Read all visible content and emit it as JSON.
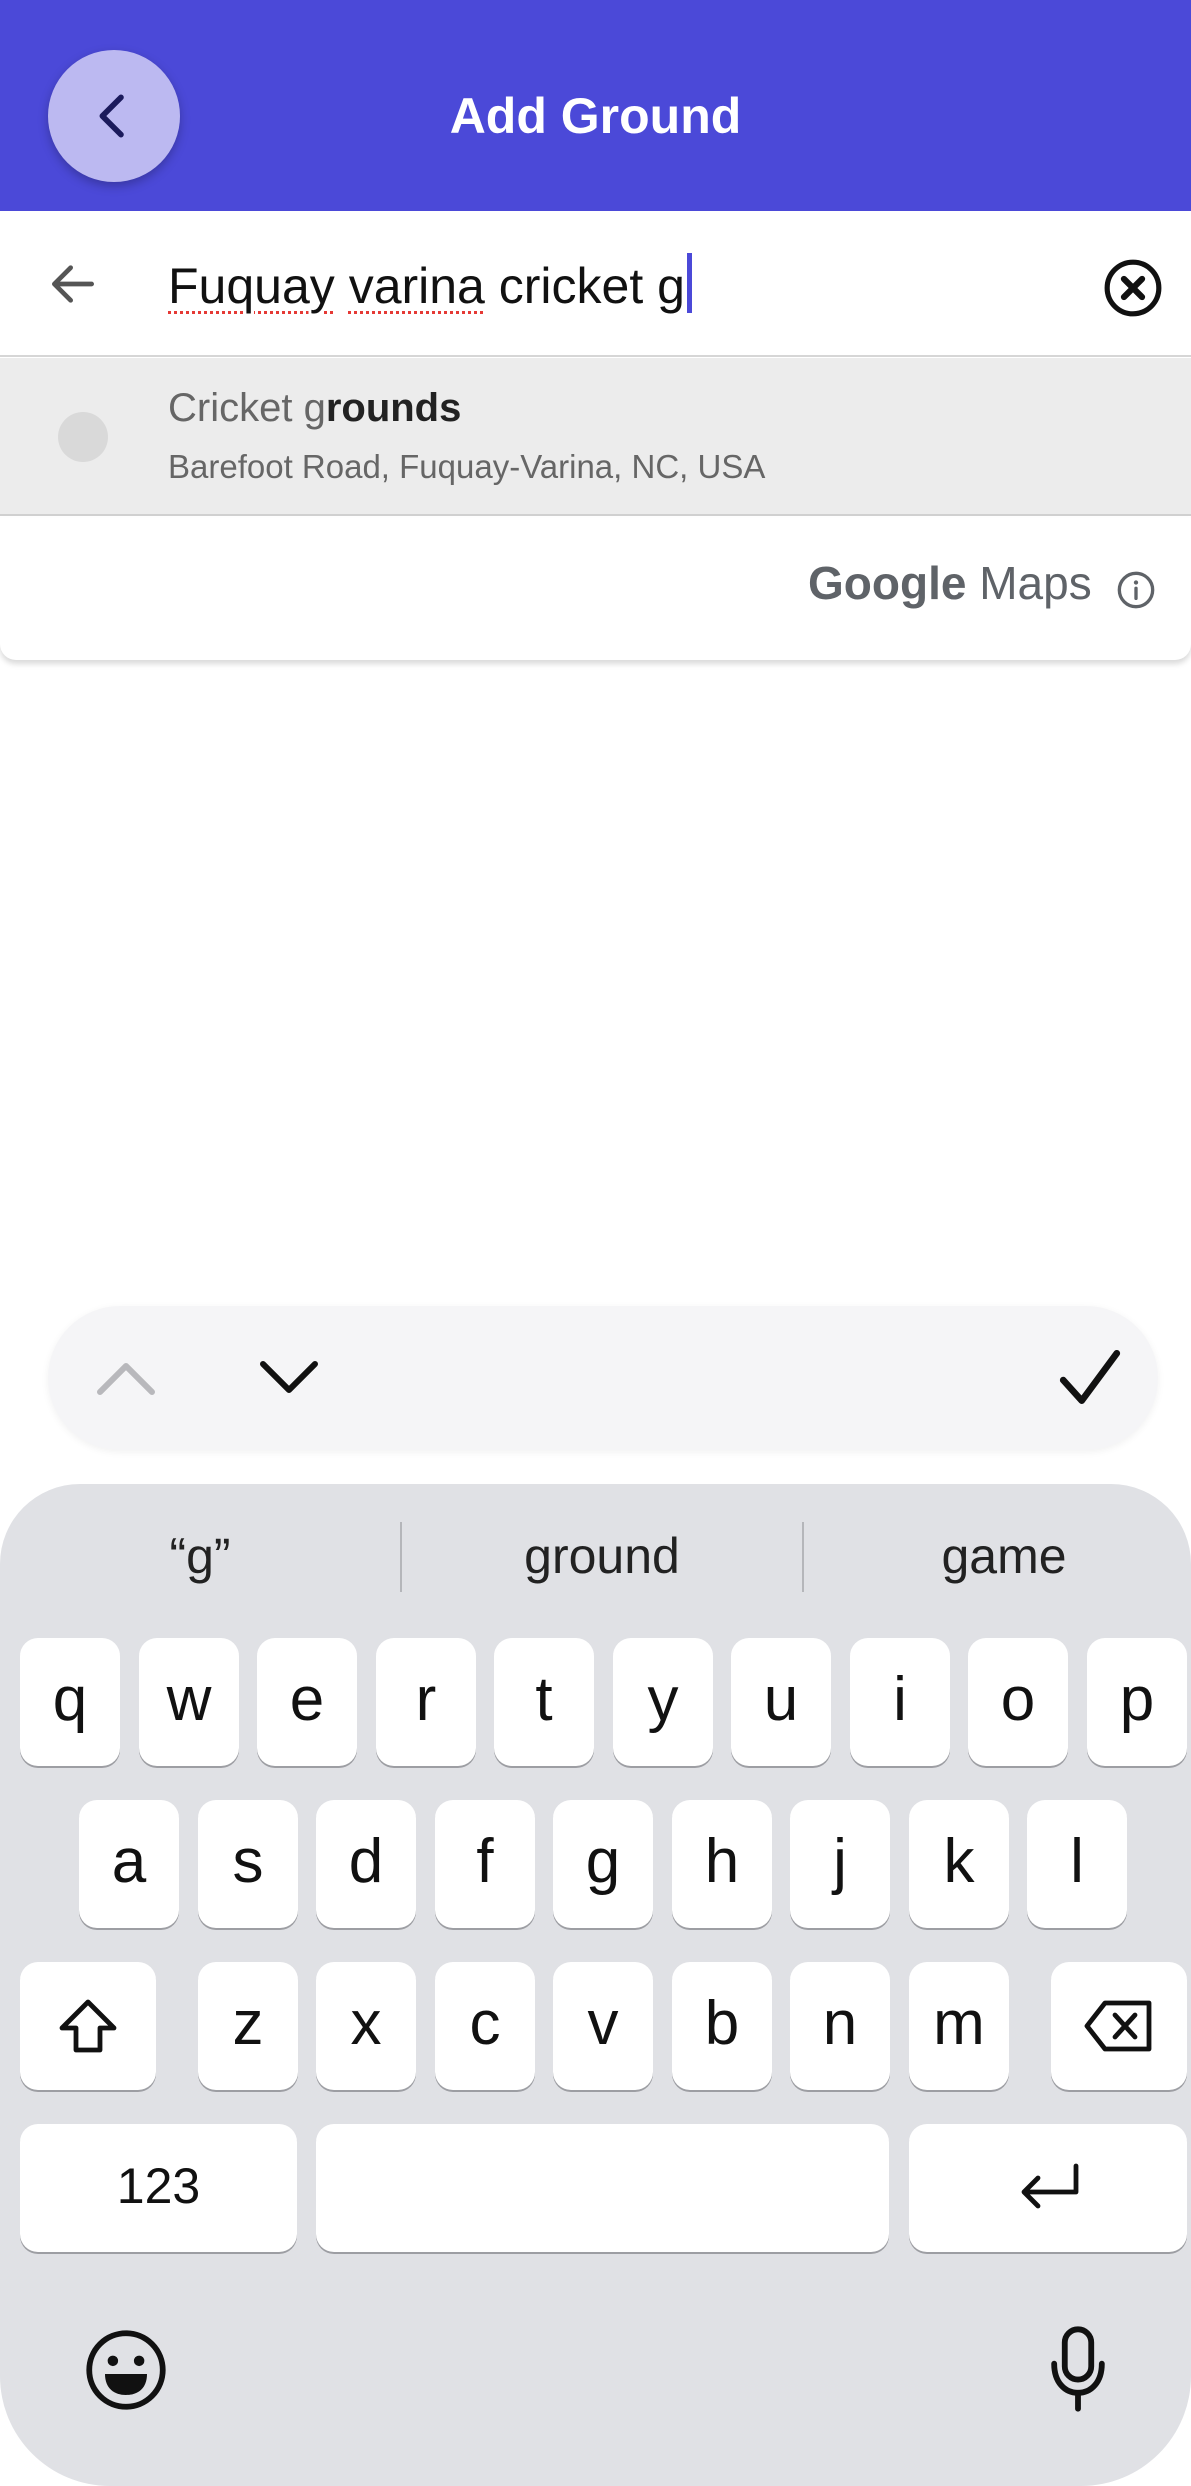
{
  "header": {
    "title": "Add Ground",
    "back_icon": "chevron-left-icon",
    "background_color": "#4b49d8"
  },
  "search": {
    "value_word1": "Fuquay",
    "value_word2": "varina",
    "value_rest": "cricket g",
    "back_icon": "arrow-left-icon",
    "clear_icon": "close-circle-icon"
  },
  "suggestion": {
    "title_match": "Cricket g",
    "title_rest": "rounds",
    "subtitle": "Barefoot Road, Fuquay-Varina, NC, USA"
  },
  "attribution": {
    "brand": "Google",
    "product": "Maps",
    "info_icon": "info-icon"
  },
  "keyboard": {
    "predictions": [
      "“g”",
      "ground",
      "game"
    ],
    "row1": [
      "q",
      "w",
      "e",
      "r",
      "t",
      "y",
      "u",
      "i",
      "o",
      "p"
    ],
    "row2": [
      "a",
      "s",
      "d",
      "f",
      "g",
      "h",
      "j",
      "k",
      "l"
    ],
    "row3": [
      "z",
      "x",
      "c",
      "v",
      "b",
      "n",
      "m"
    ],
    "numbers_label": "123",
    "shift_icon": "shift-icon",
    "backspace_icon": "backspace-icon",
    "return_icon": "return-icon",
    "emoji_icon": "emoji-icon",
    "mic_icon": "microphone-icon"
  }
}
